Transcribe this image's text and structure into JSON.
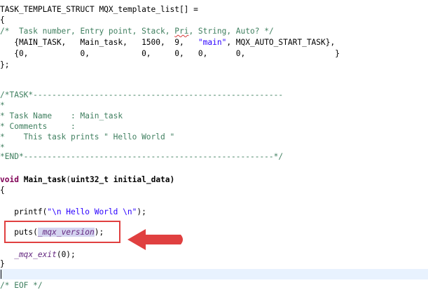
{
  "code": {
    "l01_a": "TASK_TEMPLATE_STRUCT MQX_template_list[] =",
    "l02": "{",
    "l03_a": "/*  Task number, Entry point, Stack, ",
    "l03_b": "Pri",
    "l03_c": ", String, Auto? */",
    "l04_a": "   {MAIN_TASK,   Main_task,   1500,  9,   ",
    "l04_b": "\"main\"",
    "l04_c": ", MQX_AUTO_START_TASK},",
    "l05": "   {0,           0,           0,     0,   0,      0,                   }",
    "l06": "};",
    "l09": "/*TASK*-----------------------------------------------------",
    "l10": "*",
    "l11": "* Task Name    : Main_task",
    "l12": "* Comments     :",
    "l13": "*    This task prints \" Hello World \"",
    "l14": "*",
    "l15": "*END*-----------------------------------------------------*/",
    "l17_kw": "void",
    "l17_fn": "Main_task",
    "l17_paren": "(",
    "l17_type": "uint32_t",
    "l17_rest": " initial_data)",
    "l18": "{",
    "l20_a": "   printf(",
    "l20_b": "\"\\n Hello World \\n\"",
    "l20_c": ");",
    "l22_a": "   puts(",
    "l22_b": "_mqx_version",
    "l22_c": ");",
    "l24_a": "   _mqx_exit",
    "l24_b": "(0);",
    "l25": "}",
    "l27": "/* EOF */"
  },
  "colors": {
    "comment": "#3f7f5f",
    "keyword": "#7f0055",
    "string": "#2a00ff",
    "annotation": "#e04040",
    "current_line": "#e8f2fe"
  }
}
